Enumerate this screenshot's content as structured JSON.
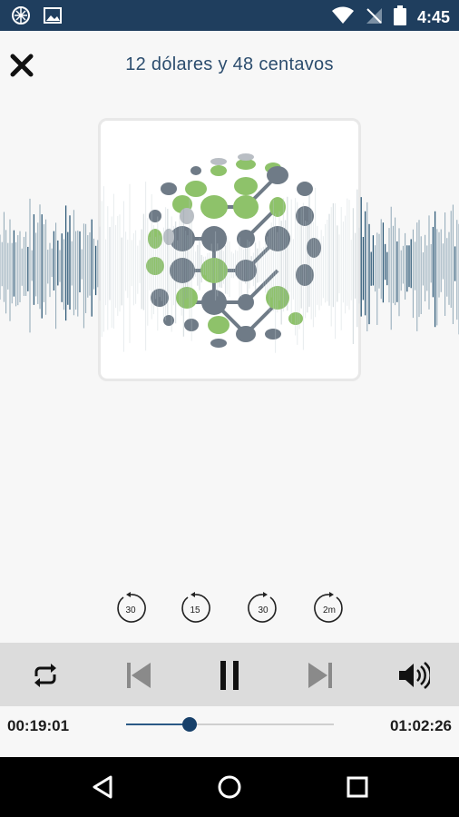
{
  "status_bar": {
    "time": "4:45"
  },
  "header": {
    "title": "12 dólares y 48 centavos"
  },
  "skip_buttons": [
    {
      "label": "30",
      "direction": "back"
    },
    {
      "label": "15",
      "direction": "back"
    },
    {
      "label": "30",
      "direction": "forward"
    },
    {
      "label": "2m",
      "direction": "forward"
    }
  ],
  "player": {
    "elapsed": "00:19:01",
    "total": "01:02:26",
    "progress": 0.3046
  },
  "colors": {
    "status_bar": "#1f3e5e",
    "title": "#2c4d6e",
    "accent": "#17406a",
    "logo_green": "#8ec26a",
    "logo_gray": "#6f7b87"
  },
  "icons": {
    "close": "close-icon",
    "repeat": "repeat-icon",
    "previous": "skip-previous-icon",
    "pause": "pause-icon",
    "next": "skip-next-icon",
    "volume": "volume-icon"
  }
}
